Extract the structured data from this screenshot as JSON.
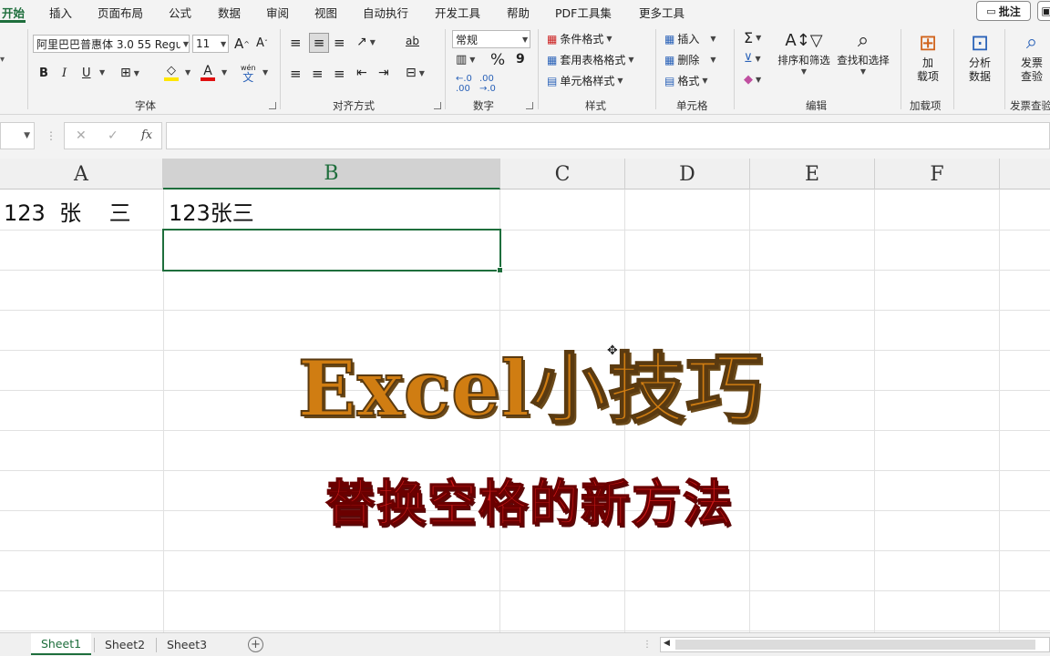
{
  "tabs": [
    {
      "label": "开始",
      "active": true
    },
    {
      "label": "插入"
    },
    {
      "label": "页面布局"
    },
    {
      "label": "公式"
    },
    {
      "label": "数据"
    },
    {
      "label": "审阅"
    },
    {
      "label": "视图"
    },
    {
      "label": "自动执行"
    },
    {
      "label": "开发工具"
    },
    {
      "label": "帮助"
    },
    {
      "label": "PDF工具集"
    },
    {
      "label": "更多工具"
    }
  ],
  "top_right": {
    "comment_label": "批注"
  },
  "ribbon": {
    "font": {
      "name": "阿里巴巴普惠体 3.0 55 Regu",
      "size": "11",
      "group_label": "字体",
      "bold": "B",
      "italic": "I",
      "underline": "U",
      "wen_label": "wén"
    },
    "align": {
      "group_label": "对齐方式",
      "ab_label": "ab"
    },
    "number": {
      "format": "常规",
      "group_label": "数字",
      "percent": "%",
      "comma": "9"
    },
    "styles": {
      "cond_format": "条件格式",
      "table_style": "套用表格格式",
      "cell_style": "单元格样式",
      "group_label": "样式"
    },
    "cells": {
      "insert": "插入",
      "delete": "删除",
      "format": "格式",
      "group_label": "单元格"
    },
    "editing": {
      "sort_filter": "排序和筛选",
      "find_select": "查找和选择",
      "group_label": "编辑",
      "sigma": "Σ"
    },
    "addins": {
      "label_line1": "加",
      "label_line2": "载项",
      "group_label": "加载项"
    },
    "analysis": {
      "label_line1": "分析",
      "label_line2": "数据"
    },
    "invoice": {
      "label_line1": "发票",
      "label_line2": "查验",
      "group_label": "发票查验"
    }
  },
  "formula_bar": {
    "cancel": "✕",
    "enter": "✓",
    "fx": "fx",
    "value": ""
  },
  "columns": [
    "A",
    "B",
    "C",
    "D",
    "E",
    "F"
  ],
  "selected_column": "B",
  "cells": {
    "A1": "123  张    三",
    "B1": "123张三"
  },
  "overlay": {
    "title": "Excel小技巧",
    "subtitle": "替换空格的新方法"
  },
  "sheets": [
    {
      "label": "Sheet1",
      "active": true
    },
    {
      "label": "Sheet2"
    },
    {
      "label": "Sheet3"
    }
  ],
  "colors": {
    "accent": "#1e6e3c",
    "title": "#d07d12",
    "subtitle": "#d11a1a"
  }
}
